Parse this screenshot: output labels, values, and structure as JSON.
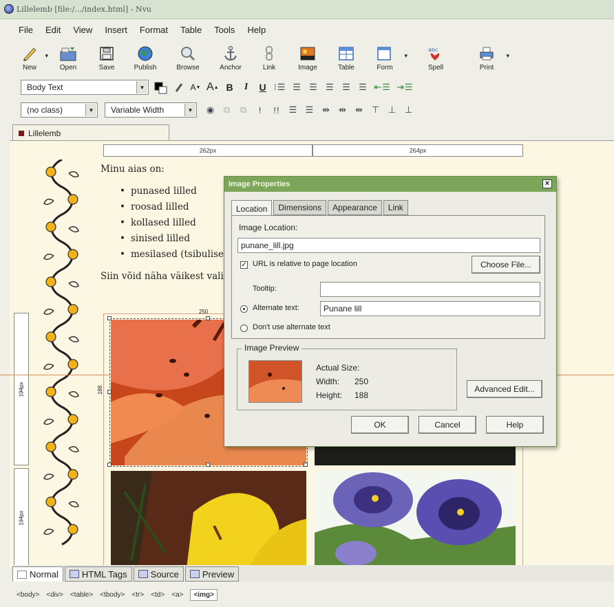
{
  "window": {
    "title": "Lillelemb [file:/.../index.html] - Nvu"
  },
  "menu": [
    "File",
    "Edit",
    "View",
    "Insert",
    "Format",
    "Table",
    "Tools",
    "Help"
  ],
  "toolbar": {
    "new": "New",
    "open": "Open",
    "save": "Save",
    "publish": "Publish",
    "browse": "Browse",
    "anchor": "Anchor",
    "link": "Link",
    "image": "Image",
    "table": "Table",
    "form": "Form",
    "spell": "Spell",
    "print": "Print"
  },
  "format_bar": {
    "paragraph_style": "Body Text",
    "class": "(no class)",
    "font": "Variable Width",
    "bold": "B",
    "italic": "I",
    "underline": "U",
    "smaller": "A",
    "larger": "A"
  },
  "document_tab": "Lillelemb",
  "ruler": {
    "col1": "262px",
    "col2": "264px",
    "row1": "194px",
    "row2": "194px"
  },
  "page": {
    "intro": "Minu aias on:",
    "list": [
      "punased lilled",
      "roosad lilled",
      "kollased lilled",
      "sinised lilled",
      "mesilased (tsibulise"
    ],
    "paragraph": "Siin võid näha väikest vali"
  },
  "selection": {
    "width_label": "250",
    "height_label": "188"
  },
  "dialog": {
    "title": "Image Properties",
    "close": "×",
    "tabs": [
      "Location",
      "Dimensions",
      "Appearance",
      "Link"
    ],
    "image_location_label": "Image Location:",
    "image_location_value": "punane_lill.jpg",
    "url_relative_label": "URL is relative to page location",
    "url_relative_checked": true,
    "choose_file": "Choose File...",
    "tooltip_label": "Tooltip:",
    "tooltip_value": "",
    "alt_text_label": "Alternate text:",
    "alt_text_value": "Punane lill",
    "no_alt_label": "Don't use alternate text",
    "preview_label": "Image Preview",
    "actual_size_label": "Actual Size:",
    "width_label": "Width:",
    "width_value": "250",
    "height_label": "Height:",
    "height_value": "188",
    "advanced_edit": "Advanced Edit...",
    "ok": "OK",
    "cancel": "Cancel",
    "help": "Help"
  },
  "mode_tabs": [
    "Normal",
    "HTML Tags",
    "Source",
    "Preview"
  ],
  "status_tags": [
    "<body>",
    "<div>",
    "<table>",
    "<tbody>",
    "<tr>",
    "<td>",
    "<a>",
    "<img>"
  ],
  "colors": {
    "dialog_title": "#7ea65a",
    "page_bg": "#fbf7e2",
    "accent_orange": "#d98a5a"
  }
}
